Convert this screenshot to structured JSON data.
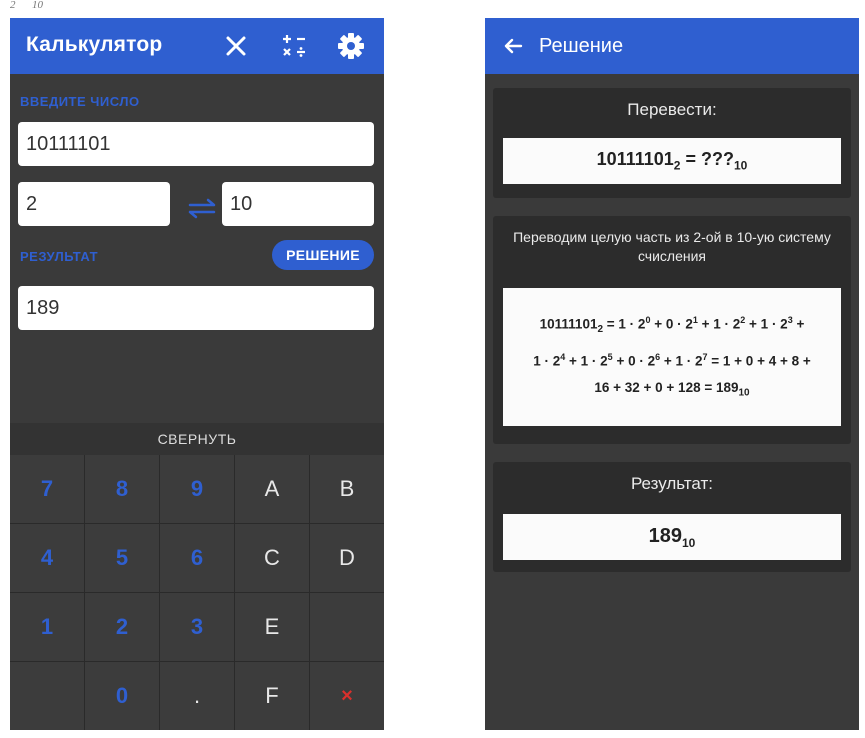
{
  "calculator": {
    "title": "Калькулятор",
    "enter_number_label": "ВВЕДИТЕ ЧИСЛО",
    "input_value": "10111101",
    "from_base": "2",
    "to_base": "10",
    "result_label": "РЕЗУЛЬТАТ",
    "solve_button": "РЕШЕНИЕ",
    "result_value": "189",
    "collapse_label": "СВЕРНУТЬ",
    "keys": [
      "7",
      "8",
      "9",
      "A",
      "B",
      "4",
      "5",
      "6",
      "C",
      "D",
      "1",
      "2",
      "3",
      "E",
      "",
      "",
      "0",
      ".",
      "F",
      "×"
    ]
  },
  "solution": {
    "title": "Решение",
    "convert_label": "Перевести:",
    "task_number": "10111101",
    "task_base_from": "2",
    "task_equals": " = ???",
    "task_base_to": "10",
    "explain_text": "Переводим целую часть из 2-ой в 10-ую систему счисления",
    "result_label": "Результат:",
    "result_number": "189",
    "result_base": "10"
  },
  "colors": {
    "accent": "#2f5fd0",
    "background": "#3a3a3a",
    "delete": "#d9302c"
  }
}
